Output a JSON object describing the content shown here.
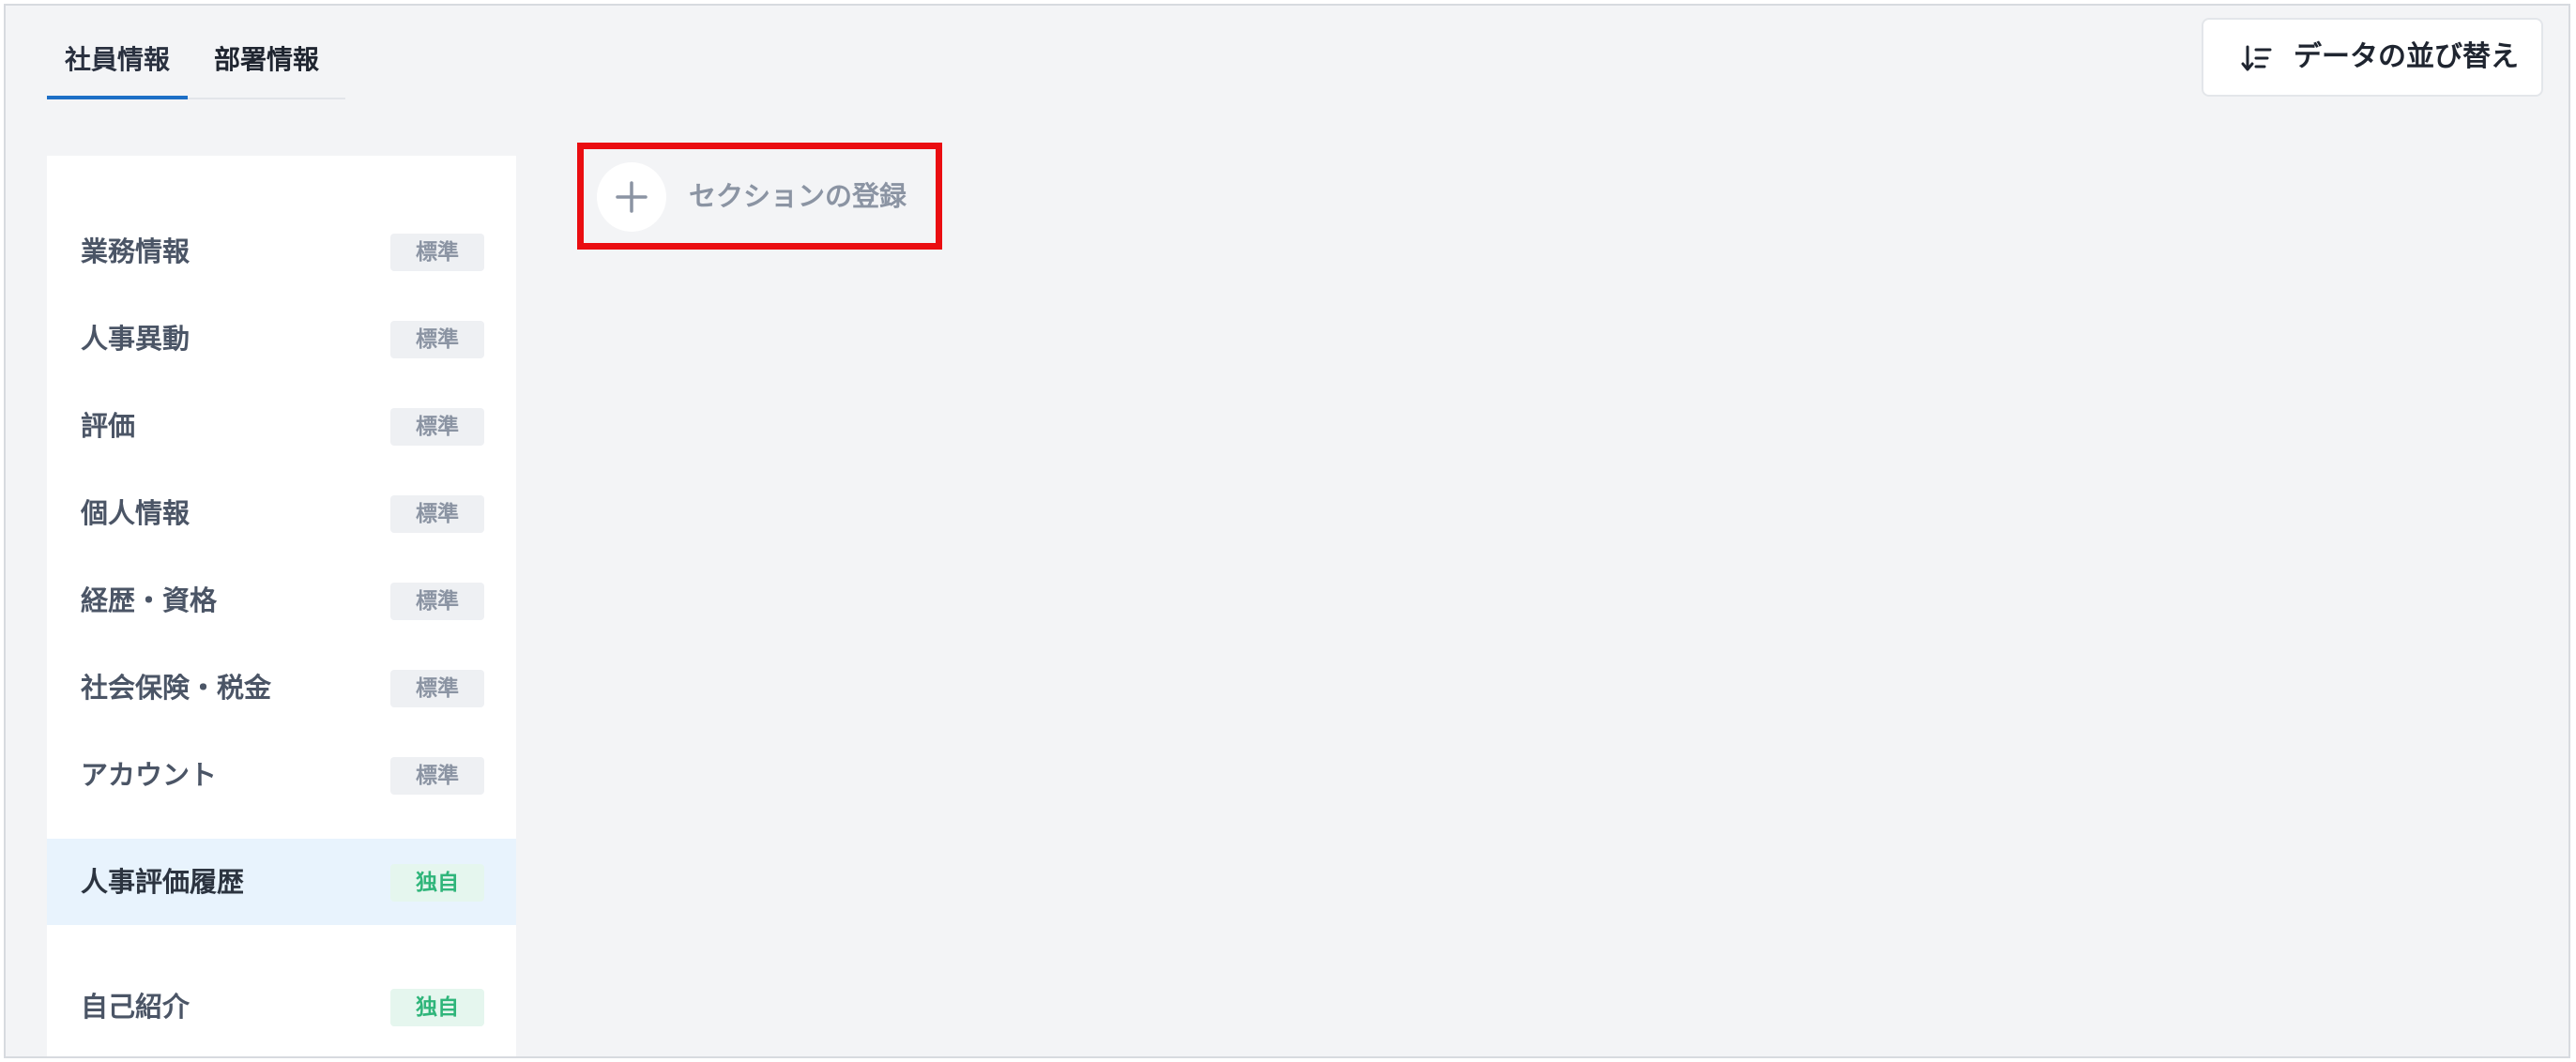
{
  "tabs": [
    {
      "label": "社員情報",
      "active": true
    },
    {
      "label": "部署情報",
      "active": false
    }
  ],
  "toolbar": {
    "sort_label": "データの並び替え",
    "sort_icon": "sort-lines-icon"
  },
  "sidebar": {
    "items": [
      {
        "label": "業務情報",
        "badge": "標準",
        "badge_type": "standard"
      },
      {
        "label": "人事異動",
        "badge": "標準",
        "badge_type": "standard"
      },
      {
        "label": "評価",
        "badge": "標準",
        "badge_type": "standard"
      },
      {
        "label": "個人情報",
        "badge": "標準",
        "badge_type": "standard"
      },
      {
        "label": "経歴・資格",
        "badge": "標準",
        "badge_type": "standard"
      },
      {
        "label": "社会保険・税金",
        "badge": "標準",
        "badge_type": "standard"
      },
      {
        "label": "アカウント",
        "badge": "標準",
        "badge_type": "standard"
      },
      {
        "label": "人事評価履歴",
        "badge": "独自",
        "badge_type": "custom",
        "active": true
      },
      {
        "label": "自己紹介",
        "badge": "独自",
        "badge_type": "custom"
      }
    ]
  },
  "main": {
    "add_section_label": "セクションの登録",
    "add_icon": "plus-icon"
  },
  "colors": {
    "accent": "#1d6fc6",
    "highlight_box": "#ea0d11",
    "custom_badge_text": "#2fb57a",
    "active_row": "#e8f3fd"
  }
}
